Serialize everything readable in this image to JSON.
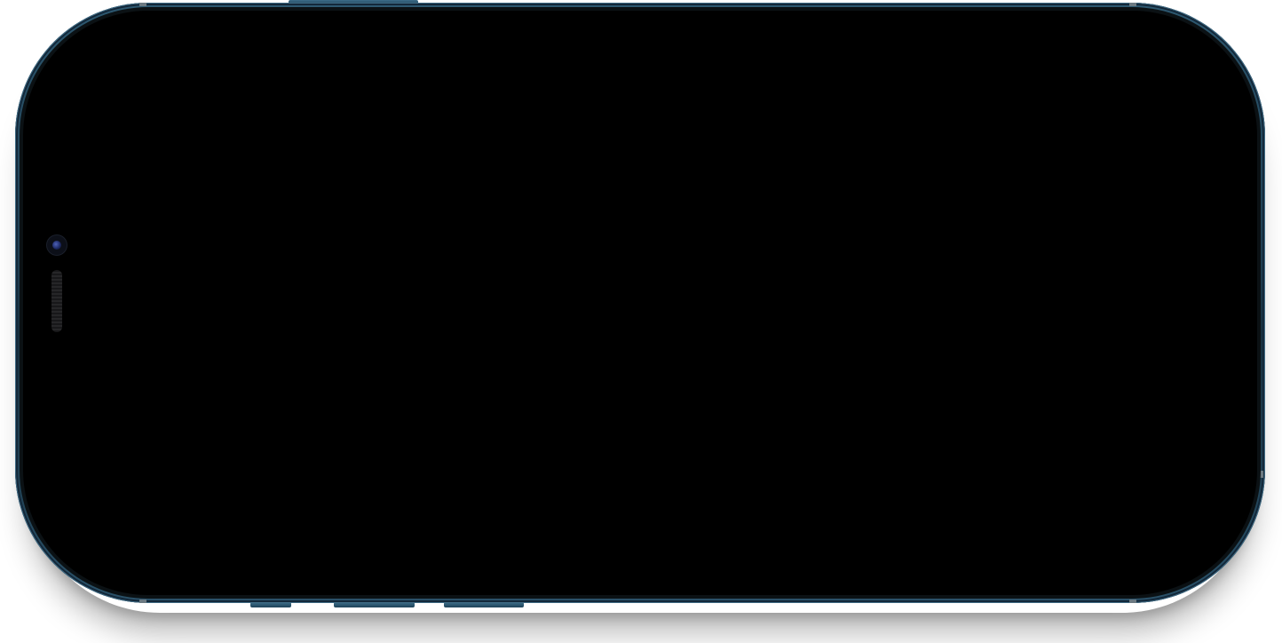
{
  "device": {
    "name": "phone-mockup",
    "frame_color": "#1e3d50",
    "screen_color": "#000000",
    "icons": [
      "front-camera-icon",
      "earpiece-speaker-icon"
    ]
  }
}
